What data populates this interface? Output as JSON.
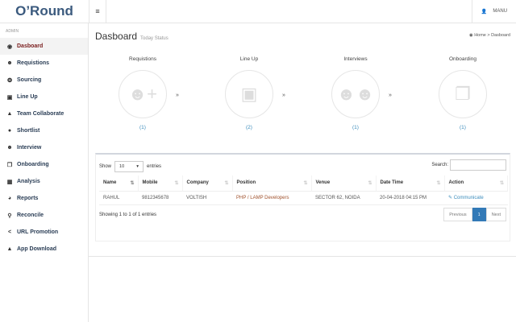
{
  "brand": "O’Round",
  "header": {
    "menu_icon": "≡",
    "user": "MANU"
  },
  "sidebar": {
    "section": "ADMIN",
    "items": [
      {
        "label": "Dasboard",
        "icon": "dashboard"
      },
      {
        "label": "Requistions",
        "icon": "user-plus"
      },
      {
        "label": "Sourcing",
        "icon": "globe"
      },
      {
        "label": "Line Up",
        "icon": "address-book"
      },
      {
        "label": "Team Collaborate",
        "icon": "sitemap"
      },
      {
        "label": "Shortlist",
        "icon": "comment"
      },
      {
        "label": "Interview",
        "icon": "users"
      },
      {
        "label": "Onboarding",
        "icon": "files"
      },
      {
        "label": "Analysis",
        "icon": "file-chart"
      },
      {
        "label": "Reports",
        "icon": "pie-chart"
      },
      {
        "label": "Reconcile",
        "icon": "search"
      },
      {
        "label": "URL Promotion",
        "icon": "share"
      },
      {
        "label": "App Download",
        "icon": "android"
      }
    ]
  },
  "page": {
    "title": "Dasboard",
    "subtitle": "Today Status",
    "breadcrumb": [
      "Home",
      "Dasboard"
    ]
  },
  "stages": [
    {
      "label": "Requistions",
      "count": "(1)"
    },
    {
      "label": "Line Up",
      "count": "(2)"
    },
    {
      "label": "Interviews",
      "count": "(1)"
    },
    {
      "label": "Onboarding",
      "count": "(1)"
    }
  ],
  "table": {
    "show": "Show",
    "entries_value": "10",
    "entries": "entries",
    "search_label": "Search:",
    "columns": [
      "Name",
      "Mobile",
      "Company",
      "Position",
      "Venue",
      "Date Time",
      "Action"
    ],
    "rows": [
      [
        "RAHUL",
        "9812345678",
        "VOLTISH",
        "PHP / LAMP Developers",
        "SECTOR 62, NOIDA",
        "20-04-2018 04:15 PM",
        "Communicate"
      ]
    ],
    "info": "Showing 1 to 1 of 1 entries",
    "prev": "Previous",
    "page": "1",
    "next": "Next"
  }
}
